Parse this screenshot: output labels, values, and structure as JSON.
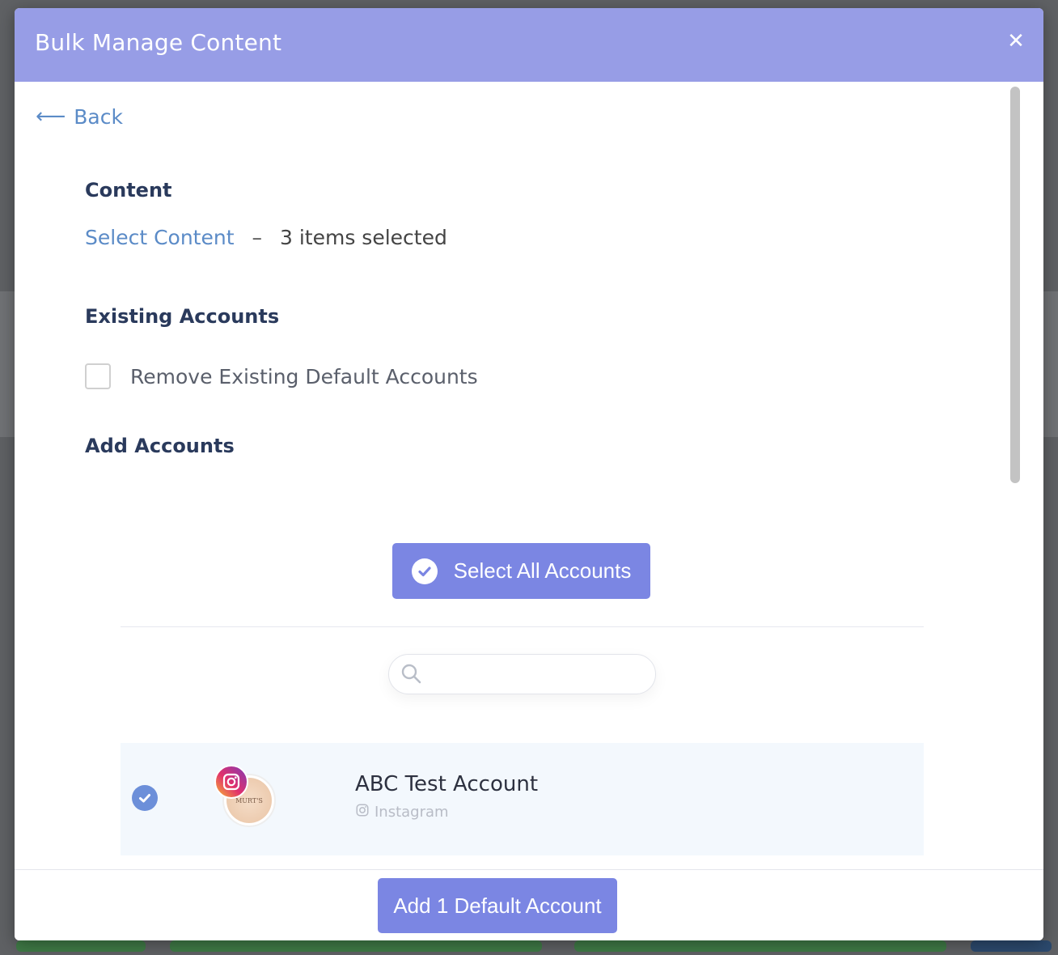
{
  "modal": {
    "title": "Bulk Manage Content",
    "close_icon": "close-icon"
  },
  "nav": {
    "back_label": "Back",
    "back_icon": "arrow-left-icon"
  },
  "content_section": {
    "title": "Content",
    "select_link": "Select Content",
    "separator": "–",
    "selected_text": "3 items selected"
  },
  "existing_accounts": {
    "title": "Existing Accounts",
    "remove_label": "Remove Existing Default Accounts",
    "remove_checked": false
  },
  "add_accounts": {
    "title": "Add Accounts",
    "select_all_label": "Select All Accounts",
    "search_placeholder": "",
    "accounts": [
      {
        "name": "ABC Test Account",
        "platform": "Instagram",
        "selected": true
      }
    ]
  },
  "footer": {
    "add_button_label": "Add 1 Default Account"
  },
  "colors": {
    "header_bg": "#979de6",
    "button_bg": "#7b86e3",
    "link": "#5b8bc7",
    "heading": "#2a3a5c",
    "row_selected_bg": "#f3f8fd",
    "check_blue": "#6c8fd9"
  }
}
